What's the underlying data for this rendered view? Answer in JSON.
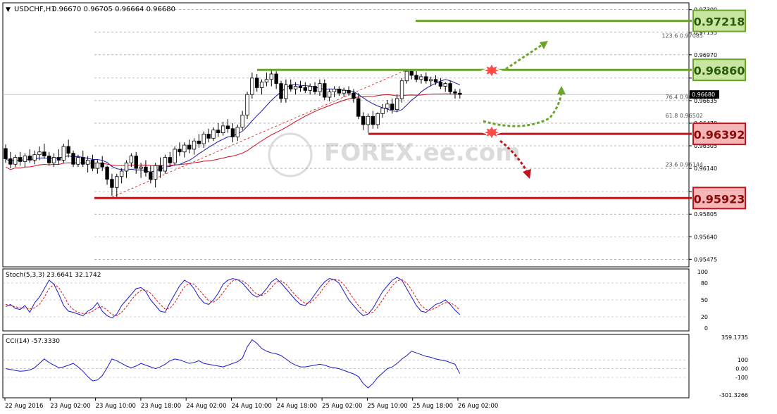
{
  "header": {
    "symbol": "USDCHF,H1",
    "ohlc": "0.96670 0.96705 0.96664 0.96680"
  },
  "main_axis": {
    "labels": [
      "0.97300",
      "0.97135",
      "0.96970",
      "0.96800",
      "0.96635",
      "0.96470",
      "0.96305",
      "0.96140",
      "0.95970",
      "0.95805",
      "0.95640",
      "0.95475"
    ],
    "current_price": "0.96680"
  },
  "fib_levels": [
    {
      "label": "123.6 0.97085"
    },
    {
      "label": "76.4 0.96638"
    },
    {
      "label": "61.8 0.96502"
    },
    {
      "label": "23.6 0.96144"
    }
  ],
  "price_boxes": [
    {
      "label": "0.97218",
      "kind": "resistance",
      "color": "#6aa52a"
    },
    {
      "label": "0.96860",
      "kind": "resistance",
      "color": "#6aa52a"
    },
    {
      "label": "0.96392",
      "kind": "support",
      "color": "#c0141c"
    },
    {
      "label": "0.95923",
      "kind": "support",
      "color": "#c0141c"
    }
  ],
  "watermark": "FOREX.ee.com",
  "stoch": {
    "title": "Stoch(5,3,3) 23.6641 32.1742",
    "levels": [
      "100",
      "80",
      "50",
      "20",
      "0"
    ]
  },
  "cci": {
    "title": "CCI(14) -57.3330",
    "levels": [
      "359.1735",
      "100",
      "0.00",
      "-100",
      "-301.3266"
    ]
  },
  "x_axis": [
    "22 Aug 2016",
    "23 Aug 02:00",
    "23 Aug 10:00",
    "23 Aug 18:00",
    "24 Aug 02:00",
    "24 Aug 10:00",
    "24 Aug 18:00",
    "25 Aug 02:00",
    "25 Aug 10:00",
    "25 Aug 18:00",
    "26 Aug 02:00"
  ],
  "colors": {
    "bull": "#ffffff",
    "bear": "#000000",
    "ma_fast": "#1a1aa0",
    "ma_slow": "#d01020",
    "stoch_main": "#1a1acc",
    "stoch_signal": "#e01010",
    "cci": "#1a1acc",
    "green": "#6aa52a",
    "red": "#c0141c"
  },
  "chart_data": {
    "type": "candlestick",
    "symbol": "USDCHF",
    "timeframe": "H1",
    "ylim": [
      0.9542,
      0.9735
    ],
    "candles": [
      [
        0.96285,
        0.96315,
        0.9618,
        0.9621
      ],
      [
        0.9621,
        0.9626,
        0.9614,
        0.9617
      ],
      [
        0.9617,
        0.9624,
        0.9615,
        0.9622
      ],
      [
        0.9622,
        0.9626,
        0.9616,
        0.9619
      ],
      [
        0.9619,
        0.9625,
        0.9615,
        0.9623
      ],
      [
        0.9623,
        0.9628,
        0.9618,
        0.962
      ],
      [
        0.962,
        0.9627,
        0.9617,
        0.9624
      ],
      [
        0.9624,
        0.963,
        0.962,
        0.9626
      ],
      [
        0.9626,
        0.9632,
        0.9621,
        0.9623
      ],
      [
        0.9623,
        0.9626,
        0.9616,
        0.9618
      ],
      [
        0.9618,
        0.9625,
        0.9615,
        0.9622
      ],
      [
        0.9622,
        0.9628,
        0.9617,
        0.962
      ],
      [
        0.962,
        0.9632,
        0.9618,
        0.963
      ],
      [
        0.963,
        0.9635,
        0.9622,
        0.9625
      ],
      [
        0.9625,
        0.9627,
        0.9615,
        0.9617
      ],
      [
        0.9617,
        0.9624,
        0.9615,
        0.9622
      ],
      [
        0.9622,
        0.9627,
        0.9615,
        0.9617
      ],
      [
        0.9617,
        0.9623,
        0.9611,
        0.962
      ],
      [
        0.962,
        0.9624,
        0.9612,
        0.9614
      ],
      [
        0.9614,
        0.962,
        0.961,
        0.9618
      ],
      [
        0.9618,
        0.9623,
        0.9612,
        0.9615
      ],
      [
        0.9615,
        0.9616,
        0.9602,
        0.9606
      ],
      [
        0.9606,
        0.961,
        0.9594,
        0.96
      ],
      [
        0.96,
        0.961,
        0.9593,
        0.9608
      ],
      [
        0.9608,
        0.9614,
        0.9603,
        0.9612
      ],
      [
        0.9612,
        0.962,
        0.9607,
        0.9618
      ],
      [
        0.9618,
        0.9625,
        0.9615,
        0.9623
      ],
      [
        0.9623,
        0.9626,
        0.961,
        0.9614
      ],
      [
        0.9614,
        0.9618,
        0.9607,
        0.9615
      ],
      [
        0.9615,
        0.962,
        0.9608,
        0.9611
      ],
      [
        0.9611,
        0.9616,
        0.9603,
        0.9606
      ],
      [
        0.9606,
        0.9618,
        0.96,
        0.9616
      ],
      [
        0.9616,
        0.9622,
        0.9607,
        0.9612
      ],
      [
        0.9612,
        0.9624,
        0.961,
        0.9622
      ],
      [
        0.9622,
        0.9626,
        0.9615,
        0.9618
      ],
      [
        0.9618,
        0.963,
        0.9616,
        0.9628
      ],
      [
        0.9628,
        0.9633,
        0.9623,
        0.9626
      ],
      [
        0.9626,
        0.9633,
        0.9622,
        0.9631
      ],
      [
        0.9631,
        0.9635,
        0.9625,
        0.9628
      ],
      [
        0.9628,
        0.9636,
        0.9624,
        0.9634
      ],
      [
        0.9634,
        0.9639,
        0.9629,
        0.9632
      ],
      [
        0.9632,
        0.9641,
        0.9629,
        0.9639
      ],
      [
        0.9639,
        0.9643,
        0.9633,
        0.9636
      ],
      [
        0.9636,
        0.9644,
        0.9634,
        0.9642
      ],
      [
        0.9642,
        0.9647,
        0.9637,
        0.964
      ],
      [
        0.964,
        0.9648,
        0.9638,
        0.9645
      ],
      [
        0.9645,
        0.965,
        0.964,
        0.9643
      ],
      [
        0.9643,
        0.9647,
        0.9633,
        0.9637
      ],
      [
        0.9637,
        0.9646,
        0.9634,
        0.9644
      ],
      [
        0.9644,
        0.9656,
        0.9642,
        0.9653
      ],
      [
        0.9653,
        0.967,
        0.965,
        0.9668
      ],
      [
        0.9668,
        0.9684,
        0.9665,
        0.968
      ],
      [
        0.968,
        0.9683,
        0.967,
        0.9673
      ],
      [
        0.9673,
        0.9679,
        0.9668,
        0.9677
      ],
      [
        0.9677,
        0.9684,
        0.9674,
        0.9679
      ],
      [
        0.9679,
        0.9686,
        0.9674,
        0.9683
      ],
      [
        0.9683,
        0.9685,
        0.9672,
        0.9676
      ],
      [
        0.9676,
        0.9678,
        0.9662,
        0.9665
      ],
      [
        0.9665,
        0.9679,
        0.9662,
        0.9675
      ],
      [
        0.9675,
        0.9679,
        0.967,
        0.9672
      ],
      [
        0.9672,
        0.9677,
        0.9668,
        0.9674
      ],
      [
        0.9674,
        0.9678,
        0.967,
        0.9673
      ],
      [
        0.9673,
        0.9677,
        0.9669,
        0.9671
      ],
      [
        0.9671,
        0.9676,
        0.9668,
        0.9674
      ],
      [
        0.9674,
        0.9677,
        0.9668,
        0.967
      ],
      [
        0.967,
        0.9679,
        0.9667,
        0.9676
      ],
      [
        0.9676,
        0.9679,
        0.9664,
        0.9666
      ],
      [
        0.9666,
        0.9672,
        0.9663,
        0.967
      ],
      [
        0.967,
        0.9674,
        0.9666,
        0.9672
      ],
      [
        0.9672,
        0.9674,
        0.9667,
        0.9669
      ],
      [
        0.9669,
        0.9673,
        0.9666,
        0.9671
      ],
      [
        0.9671,
        0.9674,
        0.9667,
        0.9669
      ],
      [
        0.9669,
        0.9672,
        0.9662,
        0.9665
      ],
      [
        0.9665,
        0.9669,
        0.965,
        0.9652
      ],
      [
        0.9652,
        0.9655,
        0.9642,
        0.9646
      ],
      [
        0.9646,
        0.9654,
        0.964,
        0.9652
      ],
      [
        0.9652,
        0.9656,
        0.9643,
        0.9646
      ],
      [
        0.9646,
        0.9655,
        0.9643,
        0.9654
      ],
      [
        0.9654,
        0.9661,
        0.9651,
        0.9658
      ],
      [
        0.9658,
        0.9664,
        0.9655,
        0.9661
      ],
      [
        0.9661,
        0.9665,
        0.9654,
        0.9657
      ],
      [
        0.9657,
        0.9668,
        0.9655,
        0.9665
      ],
      [
        0.9665,
        0.968,
        0.9662,
        0.9678
      ],
      [
        0.9678,
        0.9686,
        0.9676,
        0.9685
      ],
      [
        0.9685,
        0.9686,
        0.9679,
        0.9682
      ],
      [
        0.9682,
        0.9685,
        0.9677,
        0.9679
      ],
      [
        0.9679,
        0.9683,
        0.9676,
        0.9681
      ],
      [
        0.9681,
        0.9684,
        0.9676,
        0.9678
      ],
      [
        0.9678,
        0.9681,
        0.9674,
        0.9679
      ],
      [
        0.9679,
        0.9682,
        0.9675,
        0.9677
      ],
      [
        0.9677,
        0.968,
        0.9672,
        0.9674
      ],
      [
        0.9674,
        0.9677,
        0.967,
        0.9676
      ],
      [
        0.9676,
        0.9678,
        0.9668,
        0.967
      ],
      [
        0.967,
        0.9672,
        0.9665,
        0.9669
      ],
      [
        0.9669,
        0.9672,
        0.9665,
        0.9668
      ]
    ],
    "support_resistance": [
      0.97218,
      0.9686,
      0.96392,
      0.95923
    ],
    "fibonacci": [
      {
        "ratio": 123.6,
        "price": 0.97085
      },
      {
        "ratio": 76.4,
        "price": 0.96638
      },
      {
        "ratio": 61.8,
        "price": 0.96502
      },
      {
        "ratio": 23.6,
        "price": 0.96144
      }
    ],
    "stochastic": {
      "ylim": [
        0,
        100
      ],
      "main": [
        38,
        42,
        35,
        33,
        40,
        28,
        45,
        55,
        70,
        85,
        78,
        60,
        40,
        30,
        28,
        25,
        22,
        30,
        35,
        45,
        30,
        22,
        18,
        25,
        40,
        50,
        60,
        70,
        72,
        65,
        50,
        40,
        30,
        28,
        45,
        60,
        75,
        85,
        80,
        70,
        55,
        45,
        42,
        50,
        62,
        78,
        85,
        88,
        86,
        80,
        70,
        60,
        55,
        60,
        70,
        82,
        88,
        80,
        70,
        60,
        50,
        42,
        40,
        48,
        60,
        72,
        82,
        88,
        86,
        80,
        65,
        50,
        40,
        30,
        22,
        25,
        35,
        50,
        65,
        75,
        85,
        90,
        85,
        70,
        55,
        40,
        30,
        28,
        35,
        42,
        45,
        50,
        42,
        32,
        24
      ],
      "signal": [
        42,
        40,
        38,
        36,
        36,
        34,
        36,
        42,
        55,
        70,
        78,
        72,
        58,
        42,
        33,
        28,
        26,
        26,
        30,
        36,
        38,
        32,
        24,
        22,
        28,
        38,
        50,
        60,
        67,
        68,
        62,
        52,
        42,
        34,
        35,
        45,
        60,
        73,
        80,
        78,
        68,
        58,
        49,
        46,
        52,
        63,
        75,
        84,
        86,
        84,
        78,
        68,
        60,
        58,
        63,
        72,
        82,
        84,
        78,
        68,
        58,
        50,
        44,
        45,
        52,
        62,
        74,
        84,
        87,
        85,
        77,
        65,
        52,
        40,
        31,
        26,
        28,
        38,
        50,
        63,
        75,
        84,
        86,
        80,
        68,
        53,
        40,
        33,
        32,
        36,
        41,
        45,
        45,
        40,
        32
      ],
      "levels": [
        20,
        50,
        80
      ]
    },
    "cci": {
      "ylim": [
        -301.3266,
        359.1735
      ],
      "values": [
        0,
        -10,
        -20,
        -30,
        -25,
        -15,
        10,
        60,
        110,
        70,
        40,
        10,
        20,
        40,
        60,
        20,
        -30,
        -90,
        -140,
        -130,
        -80,
        10,
        110,
        90,
        60,
        30,
        10,
        30,
        60,
        40,
        20,
        0,
        20,
        50,
        90,
        110,
        100,
        80,
        60,
        70,
        90,
        60,
        50,
        40,
        30,
        20,
        40,
        60,
        80,
        120,
        250,
        330,
        290,
        230,
        200,
        180,
        170,
        150,
        110,
        70,
        40,
        20,
        20,
        30,
        40,
        50,
        40,
        20,
        10,
        0,
        -20,
        -40,
        -60,
        -90,
        -170,
        -220,
        -170,
        -100,
        -50,
        0,
        20,
        60,
        110,
        150,
        200,
        180,
        160,
        140,
        130,
        110,
        100,
        90,
        70,
        50,
        -57.333
      ],
      "levels": [
        100,
        0,
        -100
      ]
    },
    "x_tick_labels": [
      "22 Aug 2016",
      "23 Aug 02:00",
      "23 Aug 10:00",
      "23 Aug 18:00",
      "24 Aug 02:00",
      "24 Aug 10:00",
      "24 Aug 18:00",
      "25 Aug 02:00",
      "25 Aug 10:00",
      "25 Aug 18:00",
      "26 Aug 02:00"
    ]
  }
}
